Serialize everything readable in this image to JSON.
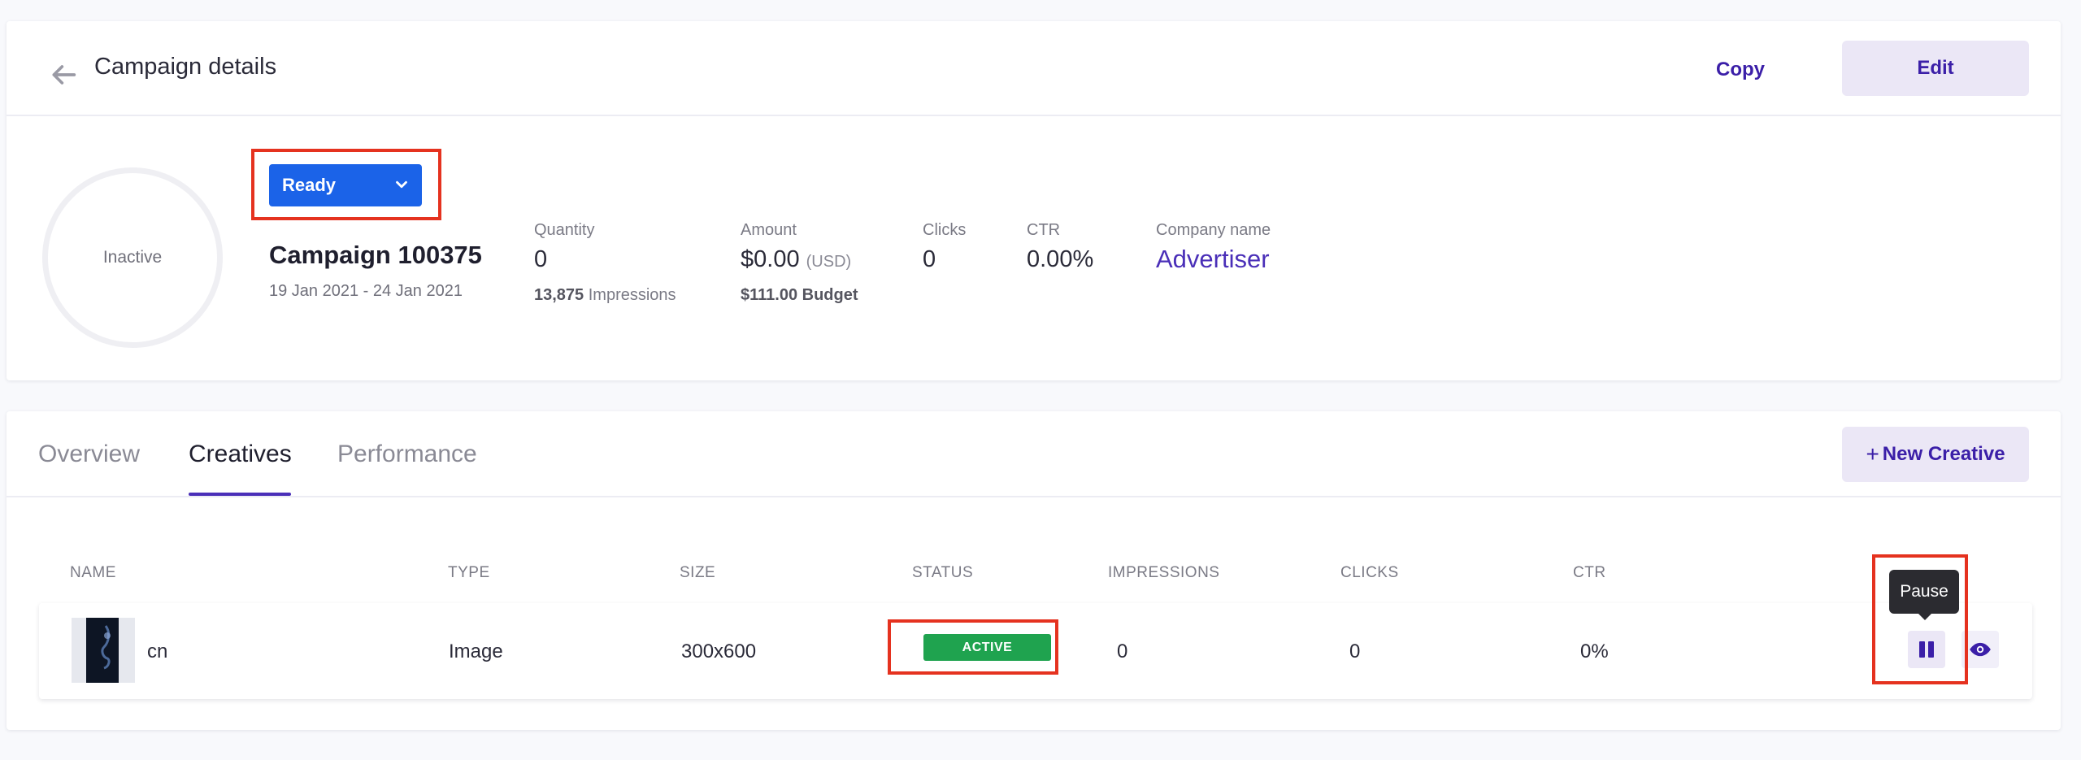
{
  "header": {
    "title": "Campaign details",
    "copy_label": "Copy",
    "edit_label": "Edit"
  },
  "summary": {
    "status_ring_label": "Inactive",
    "status_select_value": "Ready",
    "campaign_name": "Campaign 100375",
    "date_range": "19 Jan 2021 - 24 Jan 2021",
    "quantity": {
      "label": "Quantity",
      "value": "0",
      "impressions_count": "13,875",
      "impressions_label": "Impressions"
    },
    "amount": {
      "label": "Amount",
      "value": "$0.00",
      "unit": "(USD)",
      "budget": "$111.00 Budget"
    },
    "clicks": {
      "label": "Clicks",
      "value": "0"
    },
    "ctr": {
      "label": "CTR",
      "value": "0.00%"
    },
    "company": {
      "label": "Company name",
      "value": "Advertiser"
    }
  },
  "tabs": [
    {
      "label": "Overview"
    },
    {
      "label": "Creatives"
    },
    {
      "label": "Performance"
    }
  ],
  "new_creative_label": "New Creative",
  "table": {
    "columns": [
      "NAME",
      "TYPE",
      "SIZE",
      "STATUS",
      "IMPRESSIONS",
      "CLICKS",
      "CTR"
    ],
    "rows": [
      {
        "name": "cn",
        "type": "Image",
        "size": "300x600",
        "status": "ACTIVE",
        "impressions": "0",
        "clicks": "0",
        "ctr": "0%"
      }
    ]
  },
  "tooltip": "Pause",
  "colors": {
    "accent": "#3b1fa8",
    "select_blue": "#1b63e8",
    "status_green": "#1fa34f",
    "highlight_red": "#e5321f"
  }
}
